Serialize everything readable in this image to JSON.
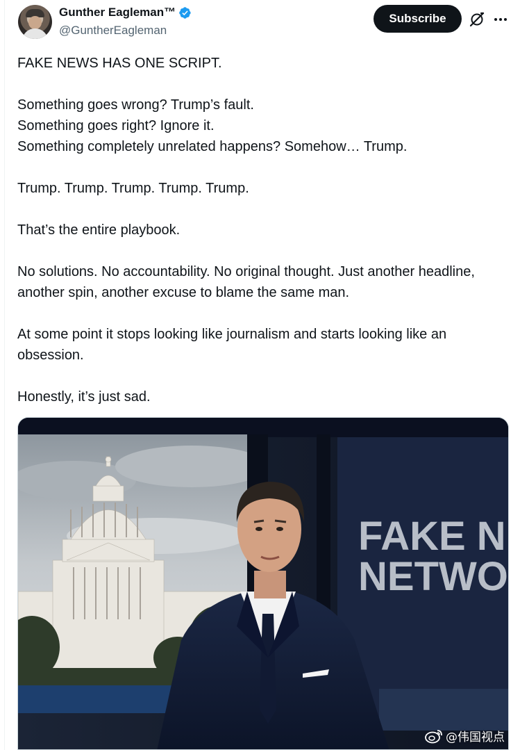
{
  "author": {
    "name": "Gunther Eagleman™",
    "handle": "@GuntherEagleman",
    "verified": true,
    "verified_color": "#1d9bf0"
  },
  "actions": {
    "subscribe_label": "Subscribe",
    "grok_icon": "grok-icon",
    "more_icon": "more-icon"
  },
  "tweet": {
    "paragraphs": [
      [
        "FAKE NEWS HAS ONE SCRIPT."
      ],
      [
        "Something goes wrong? Trump’s fault.",
        "Something goes right? Ignore it.",
        "Something completely unrelated happens? Somehow… Trump."
      ],
      [
        "Trump. Trump. Trump. Trump. Trump."
      ],
      [
        "That’s the entire playbook."
      ],
      [
        "No solutions. No accountability. No original thought. Just another headline, another spin, another excuse to blame the same man."
      ],
      [
        "At some point it stops looking like journalism and starts looking like an obsession."
      ],
      [
        "Honestly, it’s just sad."
      ]
    ]
  },
  "media": {
    "screen_text_line1": "FAKE NEWS",
    "screen_text_line2": "NETWORK"
  },
  "watermark": {
    "text": "@伟国视点",
    "icon": "weibo-icon"
  }
}
